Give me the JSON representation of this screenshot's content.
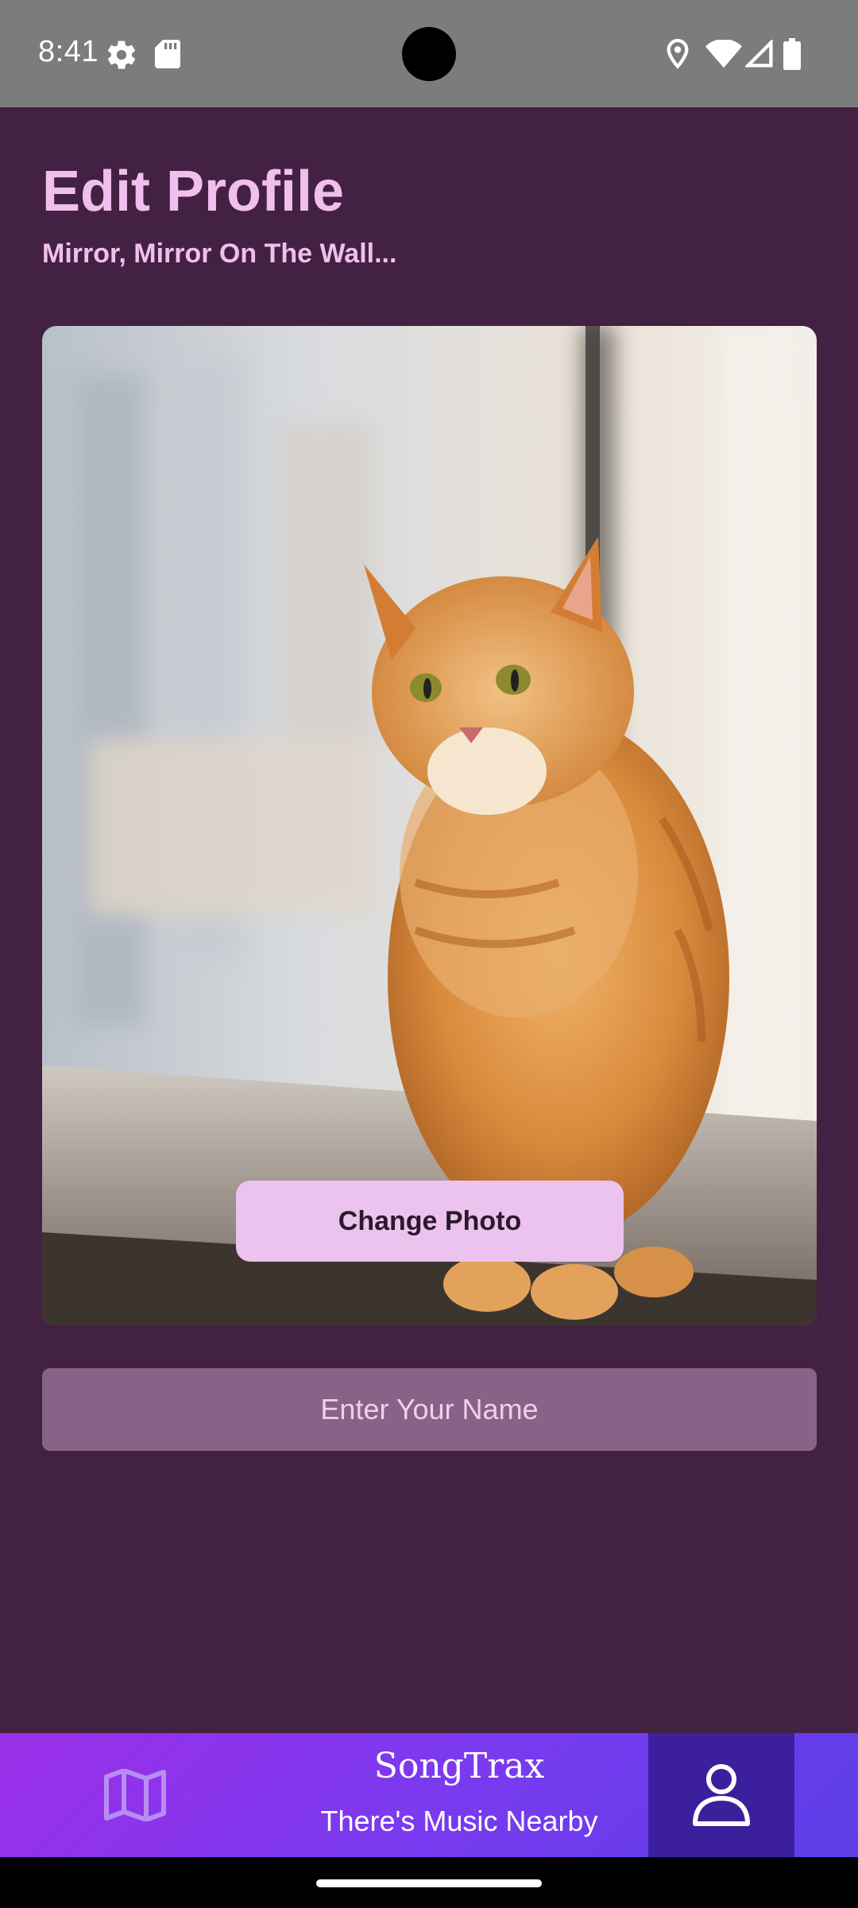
{
  "status_bar": {
    "time": "8:41",
    "left_icons": [
      "gear-icon",
      "sd-card-icon"
    ],
    "right_icons": [
      "location-icon",
      "wifi-icon",
      "signal-icon",
      "battery-icon"
    ]
  },
  "header": {
    "title": "Edit Profile",
    "subtitle": "Mirror, Mirror On The Wall..."
  },
  "profile_photo": {
    "change_button_label": "Change Photo"
  },
  "name_input": {
    "placeholder": "Enter Your Name",
    "value": ""
  },
  "bottom_nav": {
    "brand_name": "SongTrax",
    "tagline": "There's Music Nearby",
    "items": [
      {
        "icon": "map-icon",
        "active": false
      },
      {
        "icon": "profile-icon",
        "active": true
      }
    ]
  },
  "colors": {
    "background": "#432143",
    "title_text": "#f0bfee",
    "button": "#ecc2ee",
    "input": "#876387",
    "nav_gradient_start": "#9b2fe8",
    "nav_gradient_end": "#5b3ee8",
    "nav_active": "#3b1f9c"
  }
}
